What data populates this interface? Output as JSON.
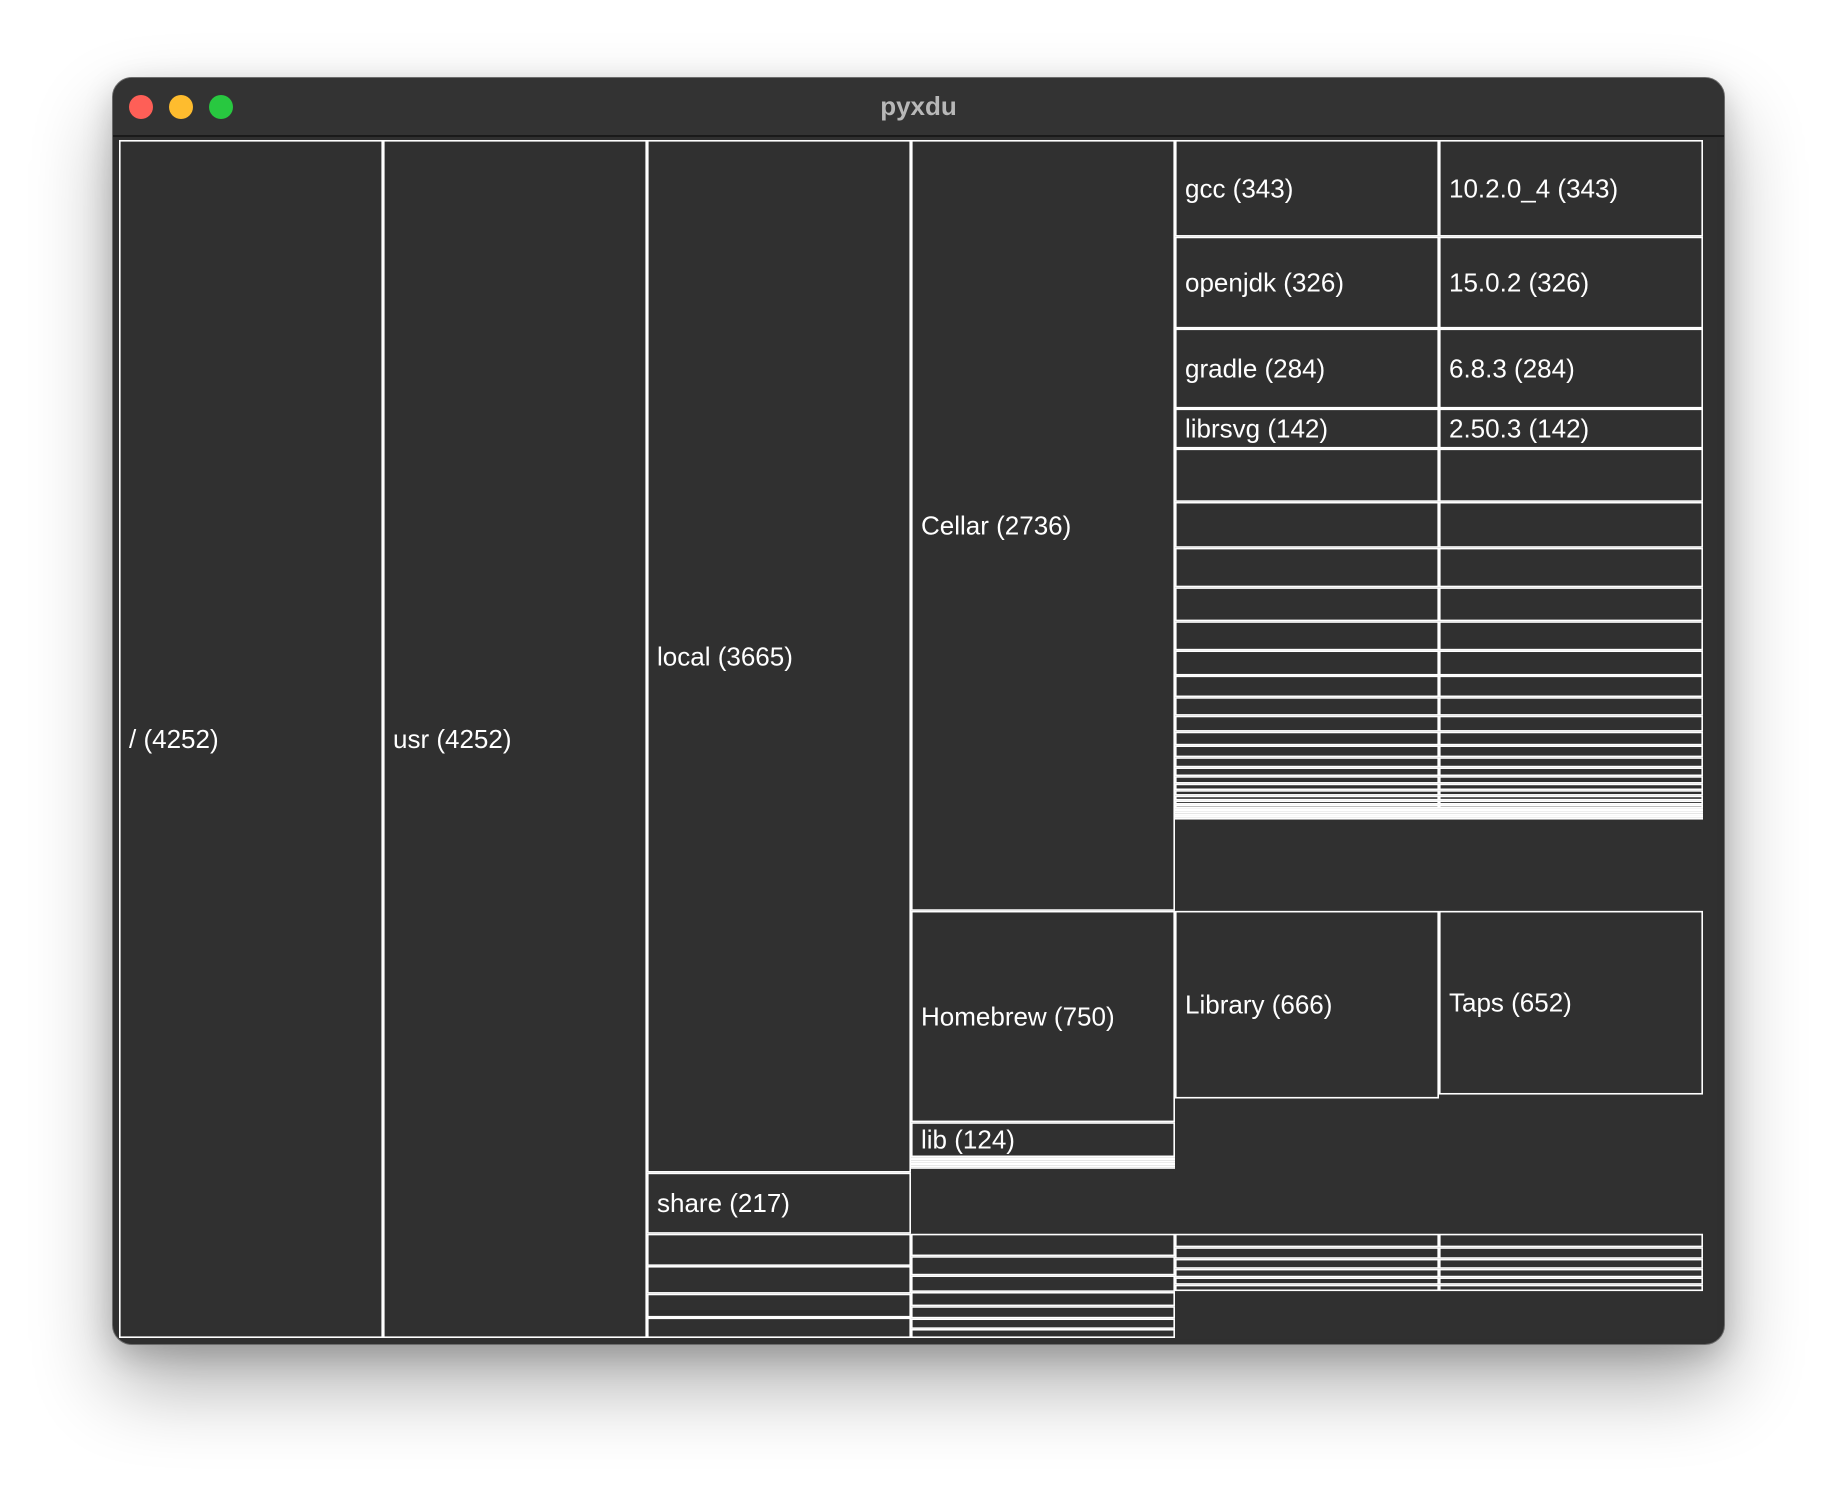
{
  "window": {
    "title": "pyxdu"
  },
  "colors": {
    "background": "#303030",
    "border": "#ffffff",
    "text": "#ffffff",
    "titlebar": "#333333",
    "close": "#fe5f57",
    "minimize": "#febc2e",
    "zoom": "#28c840"
  },
  "tree": {
    "name": "/",
    "size": 4252,
    "label": "/ (4252)",
    "children": [
      {
        "name": "usr",
        "size": 4252,
        "label": "usr (4252)",
        "children": [
          {
            "name": "local",
            "size": 3665,
            "label": "local (3665)",
            "children": [
              {
                "name": "Cellar",
                "size": 2736,
                "label": "Cellar (2736)",
                "children": [
                  {
                    "name": "gcc",
                    "size": 343,
                    "label": "gcc (343)",
                    "children": [
                      {
                        "name": "10.2.0_4",
                        "size": 343,
                        "label": "10.2.0_4 (343)"
                      }
                    ]
                  },
                  {
                    "name": "openjdk",
                    "size": 326,
                    "label": "openjdk (326)",
                    "children": [
                      {
                        "name": "15.0.2",
                        "size": 326,
                        "label": "15.0.2 (326)"
                      }
                    ]
                  },
                  {
                    "name": "gradle",
                    "size": 284,
                    "label": "gradle (284)",
                    "children": [
                      {
                        "name": "6.8.3",
                        "size": 284,
                        "label": "6.8.3 (284)"
                      }
                    ]
                  },
                  {
                    "name": "librsvg",
                    "size": 142,
                    "label": "librsvg (142)",
                    "children": [
                      {
                        "name": "2.50.3",
                        "size": 142,
                        "label": "2.50.3 (142)"
                      }
                    ]
                  }
                ]
              },
              {
                "name": "Homebrew",
                "size": 750,
                "label": "Homebrew (750)",
                "children": [
                  {
                    "name": "Library",
                    "size": 666,
                    "label": "Library (666)",
                    "children": [
                      {
                        "name": "Taps",
                        "size": 652,
                        "label": "Taps (652)"
                      }
                    ]
                  }
                ]
              },
              {
                "name": "lib",
                "size": 124,
                "label": "lib (124)"
              }
            ]
          },
          {
            "name": "share",
            "size": 217,
            "label": "share (217)"
          }
        ]
      }
    ]
  }
}
